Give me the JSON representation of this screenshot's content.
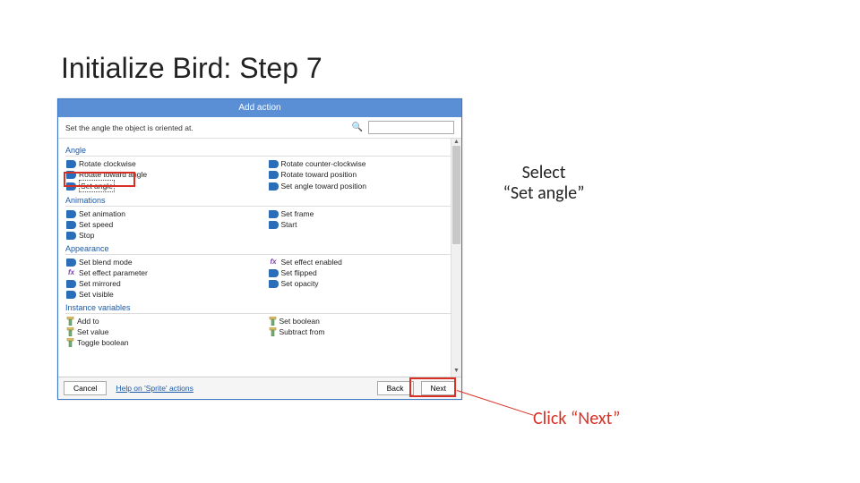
{
  "slide_title": "Initialize Bird: Step 7",
  "dialog": {
    "title": "Add action",
    "description": "Set the angle the object is oriented at.",
    "search_placeholder": "",
    "help_link": "Help on 'Sprite' actions",
    "buttons": {
      "cancel": "Cancel",
      "back": "Back",
      "next": "Next"
    }
  },
  "groups": [
    {
      "name": "Angle",
      "items": [
        {
          "label": "Rotate clockwise",
          "icon": "sprite"
        },
        {
          "label": "Rotate counter-clockwise",
          "icon": "sprite"
        },
        {
          "label": "Rotate toward angle",
          "icon": "sprite"
        },
        {
          "label": "Rotate toward position",
          "icon": "sprite"
        },
        {
          "label": "Set angle",
          "icon": "sprite",
          "selected": true
        },
        {
          "label": "Set angle toward position",
          "icon": "sprite"
        }
      ]
    },
    {
      "name": "Animations",
      "items": [
        {
          "label": "Set animation",
          "icon": "sprite"
        },
        {
          "label": "Set frame",
          "icon": "sprite"
        },
        {
          "label": "Set speed",
          "icon": "sprite"
        },
        {
          "label": "Start",
          "icon": "sprite"
        },
        {
          "label": "Stop",
          "icon": "sprite"
        }
      ]
    },
    {
      "name": "Appearance",
      "items": [
        {
          "label": "Set blend mode",
          "icon": "sprite"
        },
        {
          "label": "Set effect enabled",
          "icon": "fx"
        },
        {
          "label": "Set effect parameter",
          "icon": "fx"
        },
        {
          "label": "Set flipped",
          "icon": "sprite"
        },
        {
          "label": "Set mirrored",
          "icon": "sprite"
        },
        {
          "label": "Set opacity",
          "icon": "sprite"
        },
        {
          "label": "Set visible",
          "icon": "sprite"
        }
      ]
    },
    {
      "name": "Instance variables",
      "items": [
        {
          "label": "Add to",
          "icon": "var"
        },
        {
          "label": "Set boolean",
          "icon": "var"
        },
        {
          "label": "Set value",
          "icon": "var"
        },
        {
          "label": "Subtract from",
          "icon": "var"
        },
        {
          "label": "Toggle boolean",
          "icon": "var"
        }
      ]
    }
  ],
  "callouts": {
    "c1_line1": "Select",
    "c1_line2": "“Set angle”",
    "c2": "Click “Next”"
  }
}
